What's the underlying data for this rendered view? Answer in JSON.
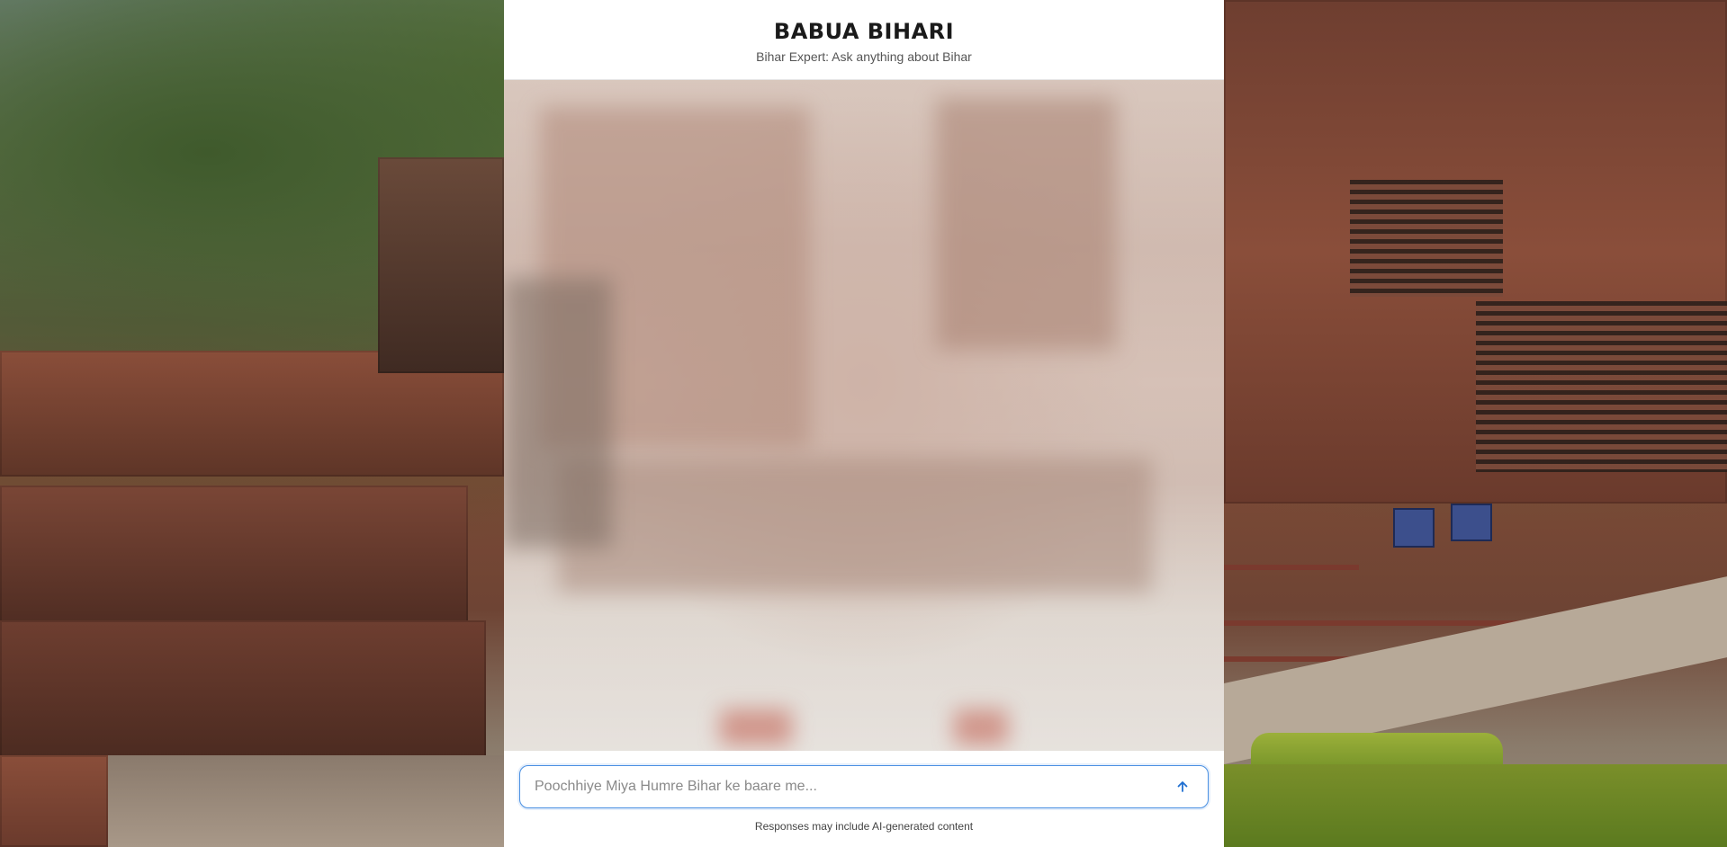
{
  "header": {
    "title": "BABUA BIHARI",
    "subtitle": "Bihar Expert: Ask anything about Bihar"
  },
  "input": {
    "placeholder": "Poochhiye Miya Humre Bihar ke baare me...",
    "value": ""
  },
  "send_button": {
    "icon": "arrow-up-icon"
  },
  "footer": {
    "disclaimer": "Responses may include AI-generated content"
  },
  "colors": {
    "input_border": "#4a90e2",
    "send_icon": "#1f6fd1",
    "header_bg": "#ffffff"
  }
}
